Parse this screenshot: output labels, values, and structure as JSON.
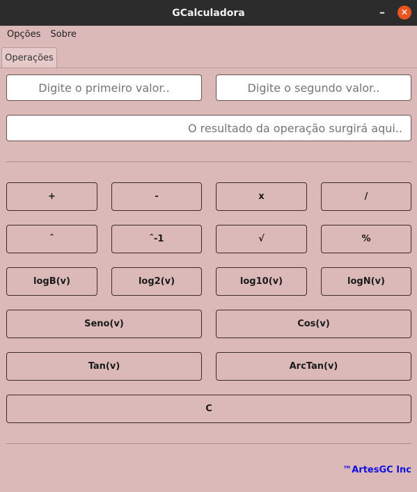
{
  "window": {
    "title": "GCalculadora",
    "minimize": "–",
    "close": "✕"
  },
  "menu": {
    "items": [
      "Opções",
      "Sobre"
    ]
  },
  "tabs": [
    {
      "label": "Operações",
      "active": true
    }
  ],
  "inputs": {
    "first_placeholder": "Digite o primeiro valor..",
    "second_placeholder": "Digite o segundo valor..",
    "result_placeholder": "O resultado da operação surgirá aqui.."
  },
  "buttons": {
    "add": "+",
    "subtract": "-",
    "multiply": "x",
    "divide": "/",
    "power": "ˆ",
    "inverse_power": "ˆ-1",
    "sqrt": "√",
    "percent": "%",
    "logB": "logB(v)",
    "log2": "log2(v)",
    "log10": "log10(v)",
    "logN": "logN(v)",
    "sine": "Seno(v)",
    "cosine": "Cos(v)",
    "tangent": "Tan(v)",
    "arctan": "ArcTan(v)",
    "clear": "C"
  },
  "footer": {
    "credit": "™ArtesGC Inc"
  },
  "colors": {
    "background": "#dcb9b9",
    "titlebar": "#2c2c2c",
    "close_button": "#e95420",
    "credit_text": "#1010e0"
  }
}
